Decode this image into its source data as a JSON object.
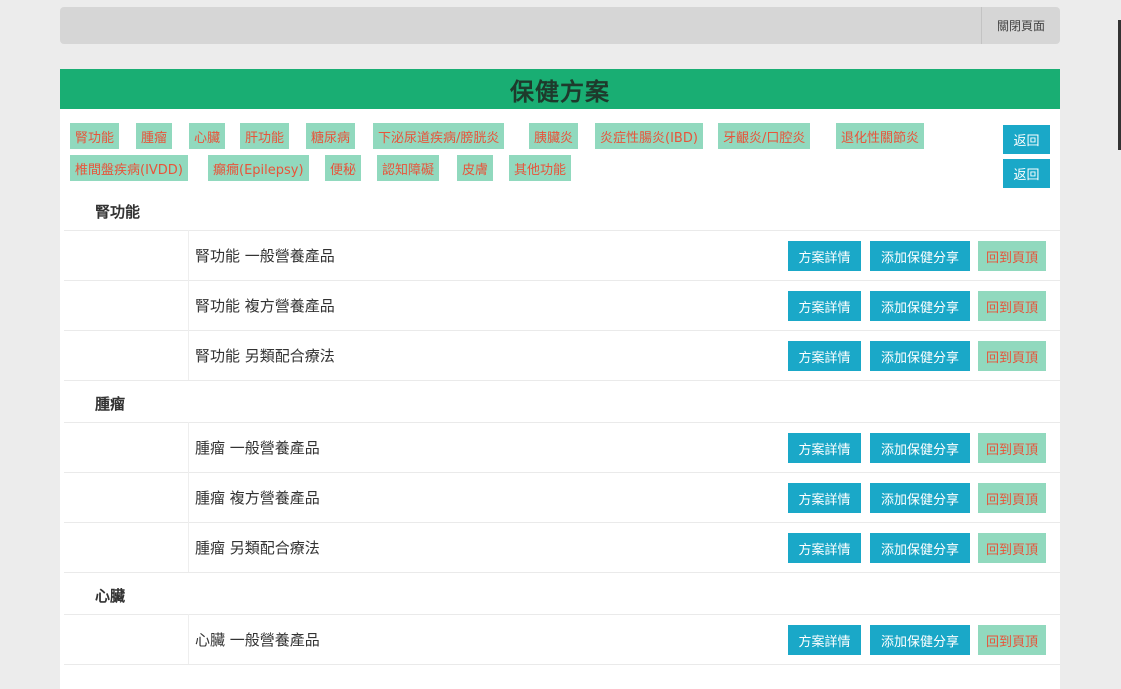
{
  "header": {
    "close_label": "關閉頁面"
  },
  "panel": {
    "title": "保健方案"
  },
  "tags": [
    "腎功能",
    "腫瘤",
    "心臟",
    "肝功能",
    "糖尿病",
    "下泌尿道疾病/膀胱炎",
    "胰臟炎",
    "炎症性腸炎(IBD)",
    "牙齦炎/口腔炎",
    "退化性關節炎",
    "椎間盤疾病(IVDD)",
    "癲癇(Epilepsy)",
    "便秘",
    "認知障礙",
    "皮膚",
    "其他功能"
  ],
  "back_buttons": [
    "返回",
    "返回"
  ],
  "actions": {
    "detail": "方案詳情",
    "share": "添加保健分享",
    "top": "回到頁頂"
  },
  "categories": [
    {
      "name": "腎功能",
      "items": [
        "腎功能 一般營養產品",
        "腎功能 複方營養產品",
        "腎功能 另類配合療法"
      ]
    },
    {
      "name": "腫瘤",
      "items": [
        "腫瘤 一般營養產品",
        "腫瘤 複方營養產品",
        "腫瘤 另類配合療法"
      ]
    },
    {
      "name": "心臟",
      "items": [
        "心臟 一般營養產品"
      ]
    }
  ]
}
